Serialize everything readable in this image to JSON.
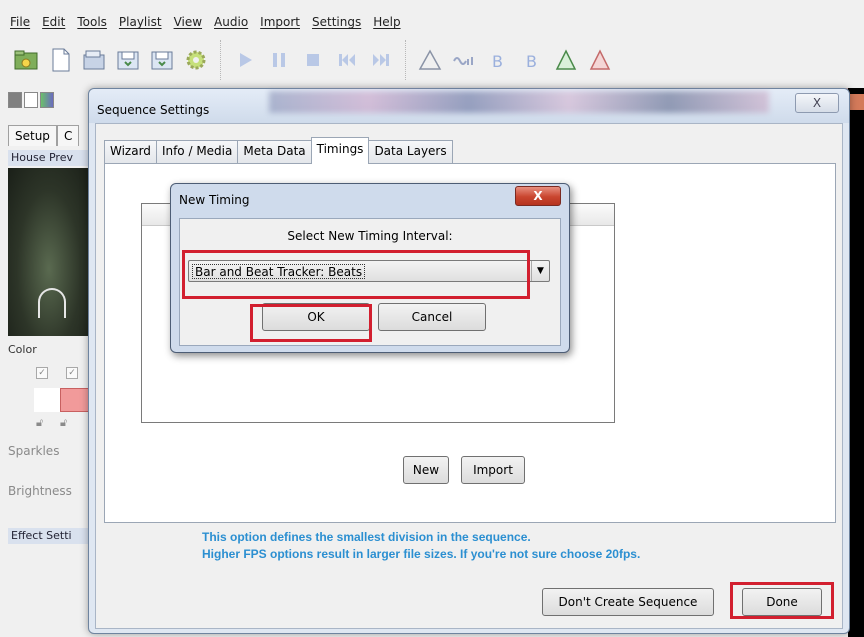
{
  "menu": [
    "File",
    "Edit",
    "Tools",
    "Playlist",
    "View",
    "Audio",
    "Import",
    "Settings",
    "Help"
  ],
  "left_panel": {
    "tab_setup": "Setup",
    "tab_c": "C",
    "house_preview": "House Prev",
    "color": "Color",
    "sparkles": "Sparkles",
    "brightness": "Brightness",
    "effect_settings": "Effect Setti"
  },
  "sequence_settings": {
    "title": "Sequence Settings",
    "close_label": "X",
    "tabs": [
      "Wizard",
      "Info / Media",
      "Meta Data",
      "Timings",
      "Data Layers"
    ],
    "active_tab": "Timings",
    "new_label": "New",
    "import_label": "Import",
    "info_line1": "This option defines the smallest division in the sequence.",
    "info_line2": "Higher FPS options result in larger file sizes.  If you're not sure choose 20fps.",
    "dont_create_label": "Don't Create Sequence",
    "done_label": "Done"
  },
  "new_timing": {
    "title": "New Timing",
    "close_label": "X",
    "prompt": "Select New Timing Interval:",
    "selected_value": "Bar and Beat Tracker: Beats",
    "ok_label": "OK",
    "cancel_label": "Cancel"
  },
  "colors": {
    "highlight": "#d21f2f",
    "info_text": "#2b8fd1"
  }
}
